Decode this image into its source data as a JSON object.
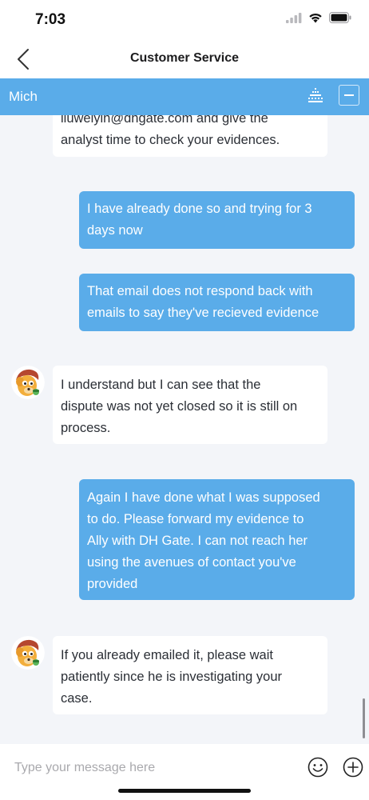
{
  "status_bar": {
    "time": "7:03",
    "icons": [
      "signal-icon",
      "wifi-icon",
      "battery-icon"
    ]
  },
  "nav": {
    "back_icon": "chevron-left-icon",
    "title": "Customer Service"
  },
  "agent_bar": {
    "name": "Mich",
    "actions": [
      "rate-icon",
      "minimize-icon"
    ],
    "color": "#5aace9"
  },
  "messages": [
    {
      "sender": "agent",
      "lines": [
        "liuweiyin@dhgate.com and give the",
        "analyst time to check your evidences."
      ]
    },
    {
      "sender": "user",
      "lines": [
        "I have already done so and trying for 3",
        "days now"
      ]
    },
    {
      "sender": "user",
      "lines": [
        "That email does not respond back with",
        "emails to say they've recieved evidence"
      ]
    },
    {
      "sender": "agent",
      "lines": [
        "I understand but I can see that the",
        "dispute was not yet closed so it is still on",
        "process."
      ]
    },
    {
      "sender": "user",
      "lines": [
        "Again I have done what I was supposed",
        "to do. Please forward my evidence to",
        "Ally with DH Gate. I can not reach her",
        "using the avenues of contact you've",
        "provided"
      ]
    },
    {
      "sender": "agent",
      "lines": [
        "If you already emailed it, please wait",
        "patiently since he is investigating your",
        "case."
      ]
    }
  ],
  "input": {
    "placeholder": "Type your message here",
    "value": "",
    "emoji_icon": "smiley-icon",
    "add_icon": "plus-circle-icon"
  },
  "colors": {
    "user_bubble": "#5aace9",
    "agent_bubble": "#ffffff",
    "chat_background": "#f3f5f9"
  }
}
